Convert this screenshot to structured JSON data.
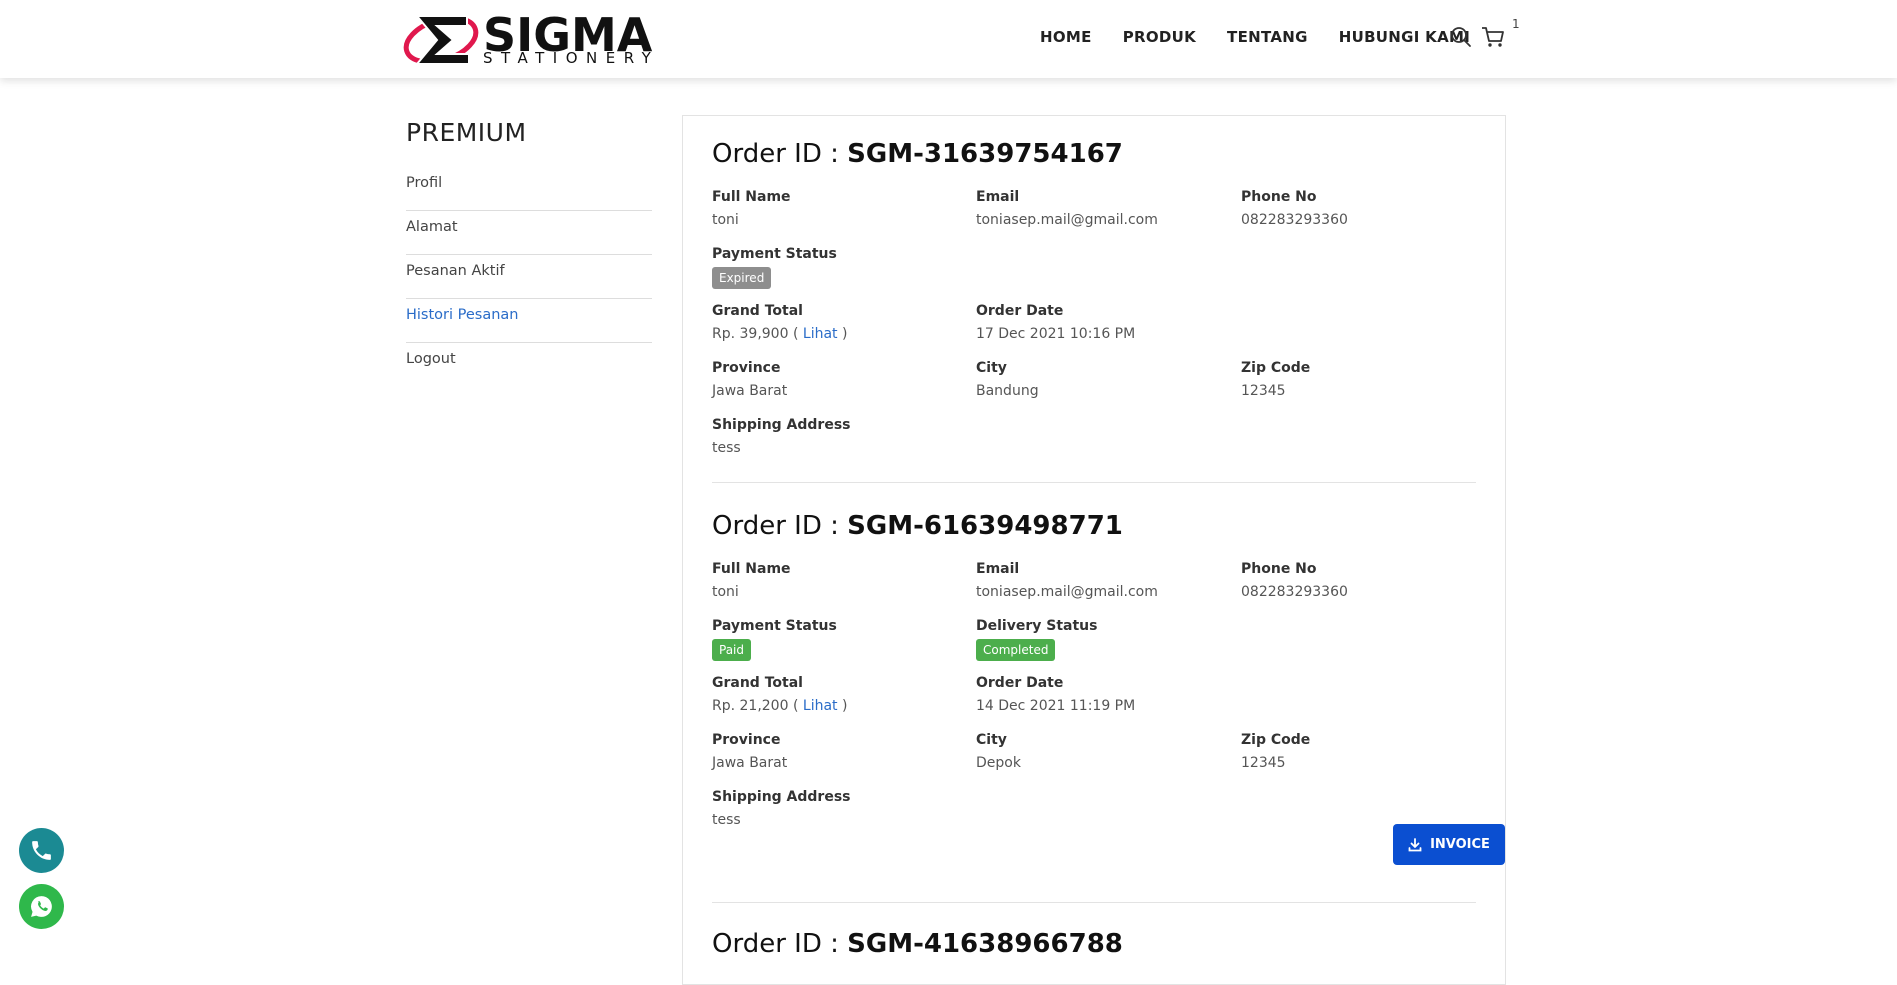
{
  "brand": {
    "logo_word": "SIGMA",
    "logo_sub": "STATIONERY",
    "colors": {
      "logo_ring": "#e0184d",
      "link": "#2a6cc8",
      "invoice_button": "#0b4fd1",
      "badge_paid": "#4cae4c",
      "badge_expired": "#8e8e8e"
    }
  },
  "nav": {
    "items": [
      "HOME",
      "PRODUK",
      "TENTANG",
      "HUBUNGI KAMI"
    ],
    "search_icon": "search-icon",
    "cart_icon": "cart-icon",
    "cart_count": "1"
  },
  "sidebar": {
    "title": "PREMIUM",
    "items": [
      {
        "label": "Profil"
      },
      {
        "label": "Alamat"
      },
      {
        "label": "Pesanan Aktif"
      },
      {
        "label": "Histori Pesanan",
        "active": true
      },
      {
        "label": "Logout"
      }
    ]
  },
  "labels": {
    "order_id_prefix": "Order ID : ",
    "full_name": "Full Name",
    "email": "Email",
    "phone": "Phone No",
    "payment_status": "Payment Status",
    "delivery_status": "Delivery Status",
    "grand_total": "Grand Total",
    "order_date": "Order Date",
    "province": "Province",
    "city": "City",
    "zip": "Zip Code",
    "shipping_address": "Shipping Address",
    "view_link": "Lihat",
    "invoice_button": "INVOICE"
  },
  "orders": [
    {
      "id": "SGM-31639754167",
      "full_name": "toni",
      "email": "toniasep.mail@gmail.com",
      "phone": "082283293360",
      "payment_status": "Expired",
      "grand_total": "Rp. 39,900",
      "order_date": "17 Dec 2021 10:16 PM",
      "province": "Jawa Barat",
      "city": "Bandung",
      "zip": "12345",
      "shipping_address": "tess"
    },
    {
      "id": "SGM-61639498771",
      "full_name": "toni",
      "email": "toniasep.mail@gmail.com",
      "phone": "082283293360",
      "payment_status": "Paid",
      "delivery_status": "Completed",
      "grand_total": "Rp. 21,200",
      "order_date": "14 Dec 2021 11:19 PM",
      "province": "Jawa Barat",
      "city": "Depok",
      "zip": "12345",
      "shipping_address": "tess"
    },
    {
      "id": "SGM-41638966788"
    }
  ],
  "floating": {
    "phone_icon": "phone-icon",
    "whatsapp_icon": "whatsapp-icon"
  }
}
